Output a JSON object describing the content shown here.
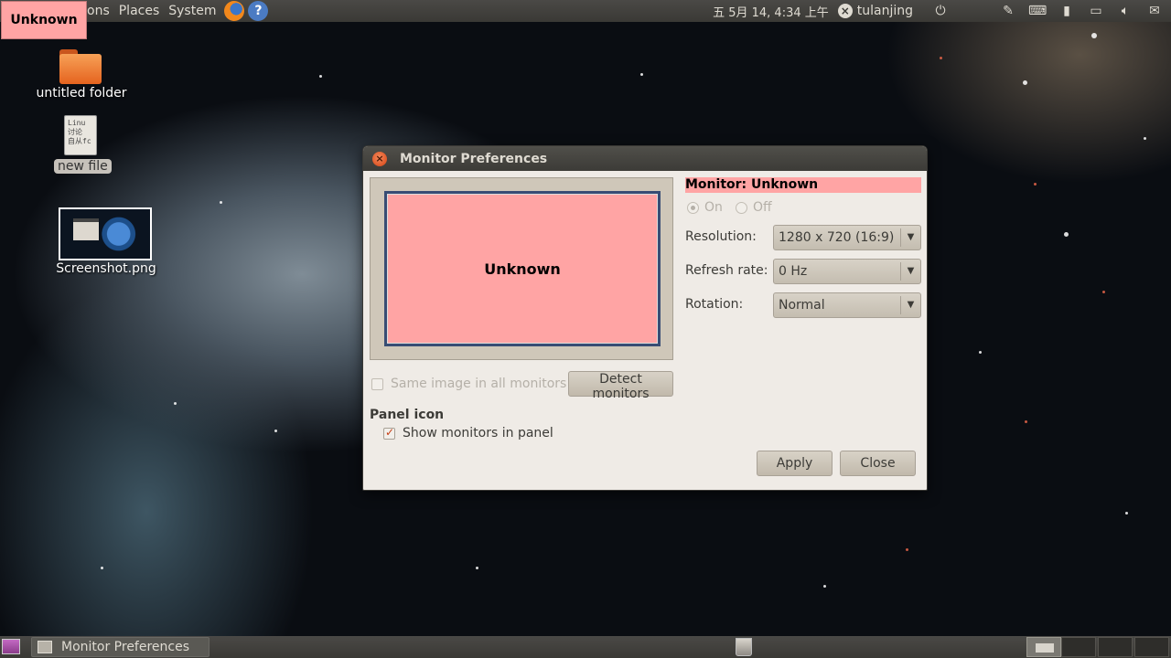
{
  "top_panel": {
    "menus": [
      "ons",
      "Places",
      "System"
    ],
    "clock": "五 5月 14, 4:34 上午",
    "user": "tulanjing"
  },
  "monitor_label": "Unknown",
  "desktop": {
    "items": [
      {
        "label": "untitled folder",
        "icon": "folder-icon"
      },
      {
        "label": "new file",
        "icon": "text-file-icon",
        "preview_text": "Linu\n讨论\n自从fc"
      },
      {
        "label": "Screenshot.png",
        "icon": "image-thumbnail"
      }
    ]
  },
  "dialog": {
    "title": "Monitor Preferences",
    "preview_label": "Unknown",
    "monitor_heading": "Monitor: Unknown",
    "radio_on": "On",
    "radio_off": "Off",
    "resolution_label": "Resolution:",
    "resolution_value": "1280 x 720 (16:9)",
    "refresh_label": "Refresh rate:",
    "refresh_value": "0 Hz",
    "rotation_label": "Rotation:",
    "rotation_value": "Normal",
    "same_image_label": "Same image in all monitors",
    "same_image_checked": false,
    "detect_button": "Detect monitors",
    "panel_icon_heading": "Panel icon",
    "show_monitors_label": "Show monitors in panel",
    "show_monitors_checked": true,
    "apply_button": "Apply",
    "close_button": "Close"
  },
  "bottom_panel": {
    "task_label": "Monitor Preferences"
  },
  "colors": {
    "monitor_highlight": "#ffa4a4",
    "panel_bg": "#3c3b37",
    "dialog_bg": "#efebe6"
  }
}
